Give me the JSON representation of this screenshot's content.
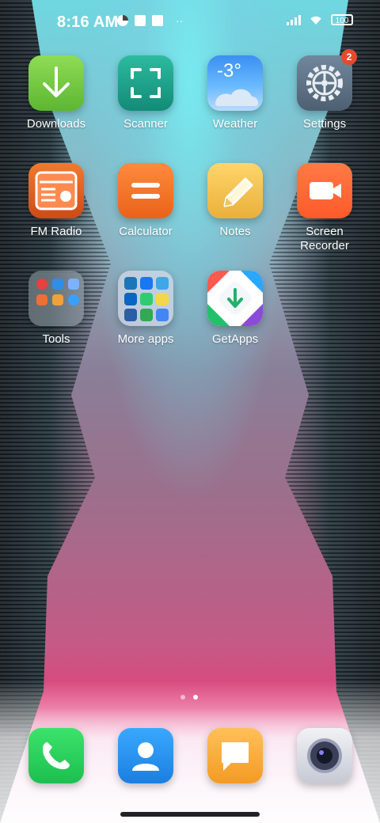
{
  "status_bar": {
    "time": "8:16 AM",
    "battery": "100"
  },
  "apps": [
    {
      "id": "downloads",
      "label": "Downloads",
      "icon": "download-arrow-icon",
      "color": "#6ecb3a"
    },
    {
      "id": "scanner",
      "label": "Scanner",
      "icon": "scan-frame-icon",
      "color": "#1aa58f"
    },
    {
      "id": "weather",
      "label": "Weather",
      "icon": "weather-cloud-icon",
      "temp": "-3°",
      "color": "#4aa6f0"
    },
    {
      "id": "settings",
      "label": "Settings",
      "icon": "gear-icon",
      "badge": "2",
      "color": "#5d7184"
    },
    {
      "id": "fm-radio",
      "label": "FM Radio",
      "icon": "radio-icon",
      "color": "#e3561f"
    },
    {
      "id": "calculator",
      "label": "Calculator",
      "icon": "equals-icon",
      "color": "#f07a28"
    },
    {
      "id": "notes",
      "label": "Notes",
      "icon": "pencil-icon",
      "color": "#f2c14e"
    },
    {
      "id": "screen-recorder",
      "label": "Screen Recorder",
      "icon": "video-camera-icon",
      "color": "#ff6a34"
    },
    {
      "id": "tools",
      "label": "Tools",
      "icon": "folder-icon",
      "color": "#9aa4ad"
    },
    {
      "id": "more-apps",
      "label": "More apps",
      "icon": "folder-icon",
      "color": "#b0b6c4"
    },
    {
      "id": "getapps",
      "label": "GetApps",
      "icon": "getapps-icon",
      "color": "#ffffff"
    }
  ],
  "dock": [
    {
      "id": "phone",
      "icon": "phone-icon",
      "color": "#2ccf5a"
    },
    {
      "id": "contacts",
      "icon": "contact-icon",
      "color": "#1f8fe6"
    },
    {
      "id": "messages",
      "icon": "message-icon",
      "color": "#f4a02b"
    },
    {
      "id": "camera",
      "icon": "camera-icon",
      "color": "#d9dbe2"
    }
  ]
}
